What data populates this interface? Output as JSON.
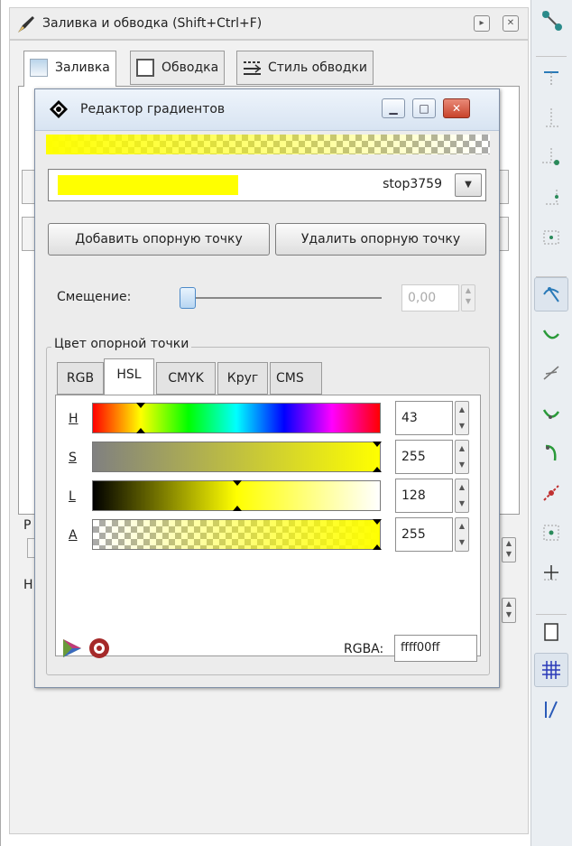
{
  "dock": {
    "title": "Заливка и обводка (Shift+Ctrl+F)",
    "header_buttons": [
      "▸",
      "✕"
    ],
    "tabs": [
      {
        "label": "Заливка",
        "icon": "fill-flat-icon"
      },
      {
        "label": "Обводка",
        "icon": "stroke-paint-icon"
      },
      {
        "label": "Стиль обводки",
        "icon": "stroke-style-icon"
      }
    ],
    "behind_labels": [
      "Р",
      "Н"
    ]
  },
  "gradient_editor": {
    "title": "Редактор градиентов",
    "stop_name": "stop3759",
    "add_stop_label": "Добавить опорную точку",
    "delete_stop_label": "Удалить опорную точку",
    "offset_label": "Смещение:",
    "offset_value": "0,00",
    "offset_fraction": 0.0,
    "stop_color_label": "Цвет опорной точки",
    "color_tabs": [
      "RGB",
      "HSL",
      "CMYK",
      "Круг",
      "CMS"
    ],
    "selected_color_tab": "HSL",
    "channels": [
      {
        "label": "H",
        "value": "43"
      },
      {
        "label": "S",
        "value": "255"
      },
      {
        "label": "L",
        "value": "128"
      },
      {
        "label": "A",
        "value": "255"
      }
    ],
    "rgba_label": "RGBA:",
    "rgba_value": "ffff00ff",
    "stop_color": "#ffff00"
  },
  "toolbar": {
    "icons": [
      "snap-enable-icon",
      "snap-bbox-icon",
      "snap-bbox-edge-icon",
      "snap-bbox-corner-icon",
      "snap-bbox-midpoint-icon",
      "snap-bbox-center-icon",
      "snap-nodes-icon",
      "snap-path-icon",
      "snap-intersection-icon",
      "snap-smooth-node-icon",
      "snap-cusp-node-icon",
      "snap-midpoint-icon",
      "snap-object-center-icon",
      "snap-rotation-center-icon",
      "snap-page-border-icon",
      "snap-grid-icon",
      "snap-guide-icon"
    ]
  }
}
